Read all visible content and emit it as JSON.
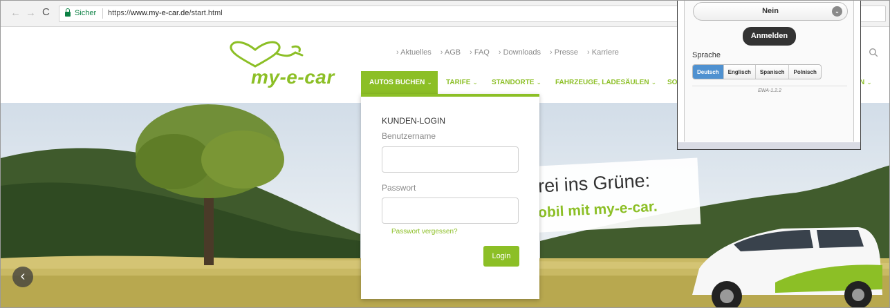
{
  "browser": {
    "back_glyph": "←",
    "forward_glyph": "→",
    "reload_glyph": "C",
    "secure_label": "Sicher",
    "url_prefix": "https://",
    "url_host": "www.my-e-car.de",
    "url_path": "/start.html"
  },
  "header": {
    "logo_text": "my-e-car",
    "top_links": [
      "Aktuelles",
      "AGB",
      "FAQ",
      "Downloads",
      "Presse",
      "Karriere"
    ],
    "nav": {
      "autos_buchen": "AUTOS BUCHEN",
      "tarife": "TARIFE",
      "standorte": "STANDORTE",
      "fahrzeuge": "FAHRZEUGE, LADESÄULEN",
      "so_partial": "SO",
      "n_partial": "N",
      "chevron": "⌄"
    }
  },
  "hero": {
    "slogan_line1": "rei ins Grüne:",
    "slogan_line2": "obil mit my-e-car.",
    "prev_arrow": "‹"
  },
  "login": {
    "title": "KUNDEN-LOGIN",
    "username_label": "Benutzername",
    "username_value": "",
    "password_label": "Passwort",
    "password_value": "",
    "forgot_link": "Passwort vergessen?",
    "submit_label": "Login"
  },
  "inset": {
    "select_value": "Nein",
    "select_icon": "⌄",
    "anmelden_label": "Anmelden",
    "sprache_label": "Sprache",
    "languages": [
      "Deutsch",
      "Englisch",
      "Spanisch",
      "Polnisch"
    ],
    "active_language": "Deutsch",
    "version": "EWA-1.2.2"
  },
  "colors": {
    "brand_green": "#8cbf26",
    "active_language_blue": "#4f91d0",
    "secure_green": "#0b8043"
  }
}
